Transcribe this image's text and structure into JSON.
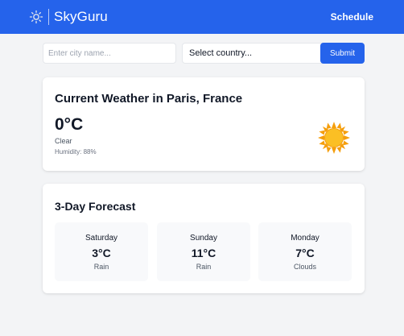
{
  "header": {
    "brand": "SkyGuru",
    "nav_schedule": "Schedule",
    "logo_icon": "sun-outline-icon",
    "bg_color": "#2563eb"
  },
  "search": {
    "city_placeholder": "Enter city name...",
    "city_value": "",
    "country_selected": "Select country...",
    "submit_label": "Submit"
  },
  "current": {
    "title": "Current Weather in Paris, France",
    "temperature": "0°C",
    "condition": "Clear",
    "humidity": "Humidity: 88%",
    "icon": "sun-icon"
  },
  "forecast": {
    "title": "3-Day Forecast",
    "days": [
      {
        "day": "Saturday",
        "temp": "3°C",
        "condition": "Rain"
      },
      {
        "day": "Sunday",
        "temp": "11°C",
        "condition": "Rain"
      },
      {
        "day": "Monday",
        "temp": "7°C",
        "condition": "Clouds"
      }
    ]
  }
}
